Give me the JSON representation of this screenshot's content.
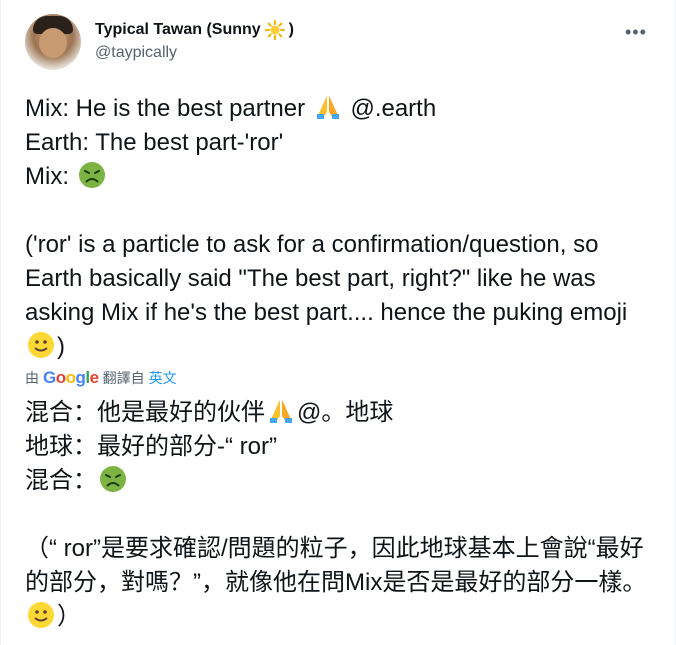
{
  "author": {
    "display_name": "Typical Tawan (Sunny",
    "name_suffix": ")",
    "handle": "@taypically"
  },
  "more_label": "•••",
  "tweet": {
    "line1": "Mix: He is the best partner ",
    "line1_tail": " @.earth",
    "line2": "Earth: The best part-'ror'",
    "line3": "Mix: ",
    "para": "('ror' is a particle to ask for a confirmation/question, so Earth basically said \"The best part, right?\" like he was asking Mix if he's the best part.... hence the puking emoji ",
    "para_tail": ")"
  },
  "translation": {
    "prefix": "由",
    "google": [
      "G",
      "o",
      "o",
      "g",
      "l",
      "e"
    ],
    "middle": "翻譯自",
    "source_lang": "英文",
    "line1": "混合：他是最好的伙伴",
    "line1_tail": "@。地球",
    "line2": "地球：最好的部分-“ ror”",
    "line3": "混合：",
    "para": "（“ ror”是要求確認/問題的粒子，因此地球基本上會說“最好的部分，對嗎？”，就像他在問Mix是否是最好的部分一樣。",
    "para_tail": "）"
  },
  "colors": {
    "text": "#0f1419",
    "secondary": "#536471",
    "link": "#1d9bf0"
  },
  "icons": [
    "sun-icon",
    "praying-hands-icon",
    "nauseated-face-icon",
    "slightly-smiling-face-icon",
    "more-icon"
  ]
}
